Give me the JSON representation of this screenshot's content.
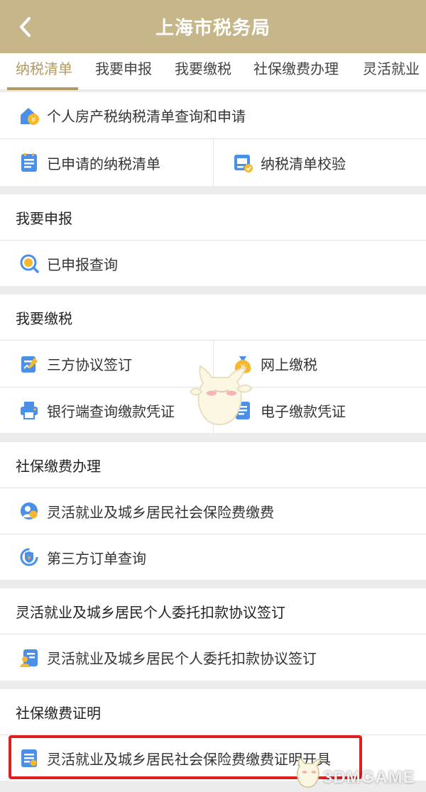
{
  "header": {
    "title": "上海市税务局"
  },
  "tabs": [
    {
      "label": "纳税清单",
      "active": true
    },
    {
      "label": "我要申报"
    },
    {
      "label": "我要缴税"
    },
    {
      "label": "社保缴费办理"
    },
    {
      "label": "灵活就业"
    }
  ],
  "tax_list": {
    "items": [
      {
        "label": "个人房产税纳税清单查询和申请",
        "icon": "house-yuan-icon"
      },
      {
        "label": "已申请的纳税清单",
        "icon": "document-icon"
      },
      {
        "label": "纳税清单校验",
        "icon": "verify-doc-icon"
      }
    ]
  },
  "declare": {
    "title": "我要申报",
    "items": [
      {
        "label": "已申报查询",
        "icon": "search-yuan-icon"
      }
    ]
  },
  "pay_tax": {
    "title": "我要缴税",
    "items": [
      {
        "label": "三方协议签订",
        "icon": "sign-doc-icon"
      },
      {
        "label": "网上缴税",
        "icon": "money-bag-icon"
      },
      {
        "label": "银行端查询缴款凭证",
        "icon": "printer-icon"
      },
      {
        "label": "电子缴款凭证",
        "icon": "receipt-icon"
      }
    ]
  },
  "social_security": {
    "title": "社保缴费办理",
    "items": [
      {
        "label": "灵活就业及城乡居民社会保险费缴费",
        "icon": "person-yuan-icon"
      },
      {
        "label": "第三方订单查询",
        "icon": "shield-yuan-icon"
      }
    ]
  },
  "entrust": {
    "title": "灵活就业及城乡居民个人委托扣款协议签订",
    "items": [
      {
        "label": "灵活就业及城乡居民个人委托扣款协议签订",
        "icon": "person-doc-icon"
      }
    ]
  },
  "certificate": {
    "title": "社保缴费证明",
    "items": [
      {
        "label": "灵活就业及城乡居民社会保险费缴费证明开具",
        "icon": "certificate-icon"
      }
    ]
  },
  "watermark": "3DMGAME",
  "colors": {
    "header": "#c7b68a",
    "accent": "#b39a5f",
    "icon_blue": "#4a8fe8",
    "icon_yellow": "#f5b82e",
    "highlight": "#e02020"
  }
}
